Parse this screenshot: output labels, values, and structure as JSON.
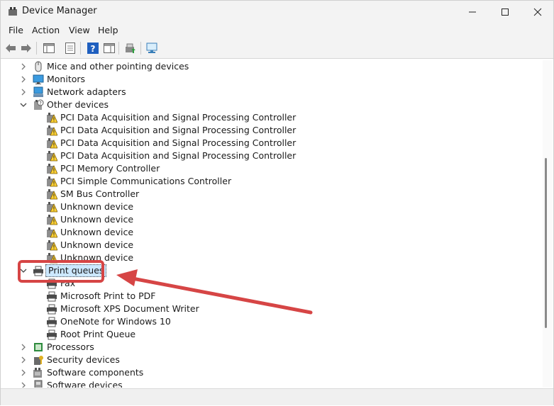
{
  "window": {
    "title": "Device Manager"
  },
  "menu": [
    "File",
    "Action",
    "View",
    "Help"
  ],
  "tree": [
    {
      "label": "Mice and other pointing devices",
      "level": 0,
      "expander": "collapsed",
      "icon": "mouse-icon"
    },
    {
      "label": "Monitors",
      "level": 0,
      "expander": "collapsed",
      "icon": "monitor-icon"
    },
    {
      "label": "Network adapters",
      "level": 0,
      "expander": "collapsed",
      "icon": "network-adapter-icon"
    },
    {
      "label": "Other devices",
      "level": 0,
      "expander": "expanded",
      "icon": "unknown-device-category-icon"
    },
    {
      "label": "PCI Data Acquisition and Signal Processing Controller",
      "level": 1,
      "icon": "warning-device-icon"
    },
    {
      "label": "PCI Data Acquisition and Signal Processing Controller",
      "level": 1,
      "icon": "warning-device-icon"
    },
    {
      "label": "PCI Data Acquisition and Signal Processing Controller",
      "level": 1,
      "icon": "warning-device-icon"
    },
    {
      "label": "PCI Data Acquisition and Signal Processing Controller",
      "level": 1,
      "icon": "warning-device-icon"
    },
    {
      "label": "PCI Memory Controller",
      "level": 1,
      "icon": "warning-device-icon"
    },
    {
      "label": "PCI Simple Communications Controller",
      "level": 1,
      "icon": "warning-device-icon"
    },
    {
      "label": "SM Bus Controller",
      "level": 1,
      "icon": "warning-device-icon"
    },
    {
      "label": "Unknown device",
      "level": 1,
      "icon": "warning-device-icon"
    },
    {
      "label": "Unknown device",
      "level": 1,
      "icon": "warning-device-icon"
    },
    {
      "label": "Unknown device",
      "level": 1,
      "icon": "warning-device-icon"
    },
    {
      "label": "Unknown device",
      "level": 1,
      "icon": "warning-device-icon"
    },
    {
      "label": "Unknown device",
      "level": 1,
      "icon": "warning-device-icon"
    },
    {
      "label": "Print queues",
      "level": 0,
      "expander": "expanded",
      "icon": "printer-icon",
      "selected": true
    },
    {
      "label": "Fax",
      "level": 1,
      "icon": "printer-icon"
    },
    {
      "label": "Microsoft Print to PDF",
      "level": 1,
      "icon": "printer-icon"
    },
    {
      "label": "Microsoft XPS Document Writer",
      "level": 1,
      "icon": "printer-icon"
    },
    {
      "label": "OneNote for Windows 10",
      "level": 1,
      "icon": "printer-icon"
    },
    {
      "label": "Root Print Queue",
      "level": 1,
      "icon": "printer-icon"
    },
    {
      "label": "Processors",
      "level": 0,
      "expander": "collapsed",
      "icon": "processor-icon"
    },
    {
      "label": "Security devices",
      "level": 0,
      "expander": "collapsed",
      "icon": "security-key-icon"
    },
    {
      "label": "Software components",
      "level": 0,
      "expander": "collapsed",
      "icon": "software-component-icon"
    },
    {
      "label": "Software devices",
      "level": 0,
      "expander": "collapsed",
      "icon": "software-device-icon"
    }
  ],
  "colors": {
    "annotation": "#d64545",
    "selection": "#cce8ff"
  }
}
